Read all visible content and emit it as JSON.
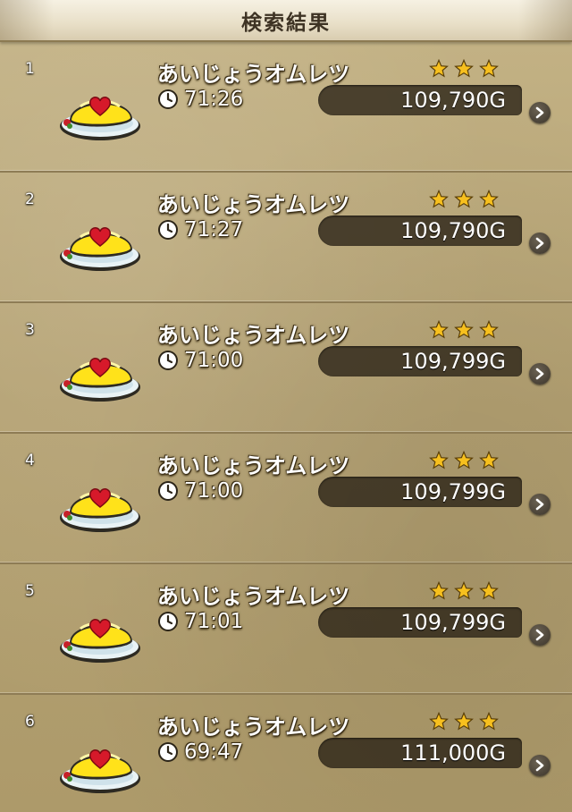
{
  "header": {
    "title": "検索結果"
  },
  "colors": {
    "star": "#f7c01e",
    "omelet": "#ffe21a",
    "heart": "#d6192a",
    "price_box": "#2a2116"
  },
  "icons": {
    "clock": "clock-icon",
    "star": "star-icon",
    "chevron": "chevron-right-icon",
    "dish": "omelet-dish-icon"
  },
  "results": [
    {
      "index": "1",
      "name": "あいじょうオムレツ",
      "time": "71:26",
      "price": "109,790G",
      "stars": 3
    },
    {
      "index": "2",
      "name": "あいじょうオムレツ",
      "time": "71:27",
      "price": "109,790G",
      "stars": 3
    },
    {
      "index": "3",
      "name": "あいじょうオムレツ",
      "time": "71:00",
      "price": "109,799G",
      "stars": 3
    },
    {
      "index": "4",
      "name": "あいじょうオムレツ",
      "time": "71:00",
      "price": "109,799G",
      "stars": 3
    },
    {
      "index": "5",
      "name": "あいじょうオムレツ",
      "time": "71:01",
      "price": "109,799G",
      "stars": 3
    },
    {
      "index": "6",
      "name": "あいじょうオムレツ",
      "time": "69:47",
      "price": "111,000G",
      "stars": 3
    }
  ]
}
